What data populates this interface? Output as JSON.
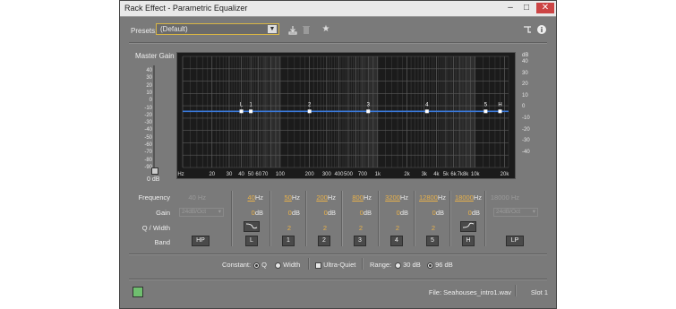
{
  "window": {
    "title": "Rack Effect - Parametric Equalizer",
    "controls": {
      "minimize": "–",
      "maximize": "□",
      "close": "✕"
    }
  },
  "toolbar": {
    "presets_label": "Presets:",
    "presets_value": "(Default)",
    "icons": [
      "save-preset-icon",
      "delete-preset-icon",
      "favorite-star-icon",
      "routing-icon",
      "info-icon"
    ]
  },
  "master_gain": {
    "label": "Master Gain",
    "scale": [
      "40",
      "30",
      "20",
      "10",
      "0",
      "-10",
      "-20",
      "-30",
      "-40",
      "-50",
      "-60",
      "-70",
      "-80",
      "-90"
    ],
    "value": "0",
    "unit": "dB"
  },
  "graph": {
    "db_unit": "dB",
    "db_scale": [
      "40",
      "30",
      "20",
      "10",
      "0",
      "-10",
      "-20",
      "-30",
      "-40"
    ],
    "freq_labels": [
      "Hz",
      "20",
      "30",
      "40",
      "50",
      "60",
      "70",
      "100",
      "200",
      "300",
      "400",
      "500",
      "700",
      "1k",
      "2k",
      "3k",
      "4k",
      "5k",
      "6k",
      "7k",
      "8k",
      "10k",
      "20k"
    ],
    "band_markers": [
      "L",
      "1",
      "2",
      "3",
      "4",
      "5",
      "H"
    ],
    "curve_color": "#3a78d8",
    "grid_color": "#5a5a5a"
  },
  "bands": {
    "row_labels": {
      "frequency": "Frequency",
      "gain": "Gain",
      "q_width": "Q / Width",
      "band": "Band"
    },
    "hp": {
      "freq": "40 Hz",
      "gain": "24dB/Oct",
      "button": "HP"
    },
    "lp": {
      "freq": "18000 Hz",
      "gain": "24dB/Oct",
      "button": "LP"
    },
    "columns": [
      {
        "freq": "40",
        "gain": "0",
        "q": "",
        "button": "L",
        "shape": "low-shelf"
      },
      {
        "freq": "50",
        "gain": "0",
        "q": "2",
        "button": "1"
      },
      {
        "freq": "200",
        "gain": "0",
        "q": "2",
        "button": "2"
      },
      {
        "freq": "800",
        "gain": "0",
        "q": "2",
        "button": "3"
      },
      {
        "freq": "3200",
        "gain": "0",
        "q": "2",
        "button": "4"
      },
      {
        "freq": "12800",
        "gain": "0",
        "q": "2",
        "button": "5"
      },
      {
        "freq": "18000",
        "gain": "0",
        "q": "",
        "button": "H",
        "shape": "high-shelf"
      }
    ],
    "hz_unit": "Hz",
    "db_unit": "dB"
  },
  "options": {
    "constant_label": "Constant:",
    "q_label": "Q",
    "width_label": "Width",
    "ultra_quiet_label": "Ultra-Quiet",
    "range_label": "Range:",
    "range_30": "30 dB",
    "range_96": "96 dB"
  },
  "status": {
    "file": "File: Seahouses_intro1.wav",
    "slot": "Slot 1"
  }
}
